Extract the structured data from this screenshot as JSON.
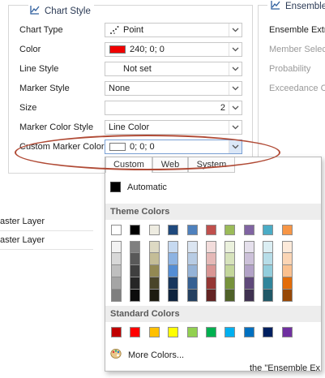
{
  "chart_style": {
    "title": "Chart Style",
    "rows": [
      {
        "label": "Chart Type",
        "value": "Point",
        "has_dropdown": true
      },
      {
        "label": "Color",
        "value": "240; 0; 0",
        "has_dropdown": true
      },
      {
        "label": "Line Style",
        "value": "Not set",
        "has_dropdown": true
      },
      {
        "label": "Marker Style",
        "value": "None",
        "has_dropdown": true
      },
      {
        "label": "Size",
        "value": "2",
        "has_dropdown": true
      },
      {
        "label": "Marker Color Style",
        "value": "Line Color",
        "has_dropdown": true
      },
      {
        "label": "Custom Marker Color",
        "value": "0; 0; 0",
        "has_dropdown": true
      }
    ],
    "color_swatch": "#f00000",
    "marker_swatch": "#ffffff"
  },
  "ensemble": {
    "title": "Ensemble",
    "labels": [
      "Ensemble Extr",
      "Member Select",
      "Probability",
      "Exceedance C"
    ]
  },
  "left_table": {
    "rows": [
      "aster Layer",
      "aster Layer"
    ]
  },
  "color_picker": {
    "tabs": [
      "Custom",
      "Web",
      "System"
    ],
    "automatic_label": "Automatic",
    "theme_title": "Theme Colors",
    "standard_title": "Standard Colors",
    "more_colors_label": "More Colors...",
    "theme_top": [
      "#ffffff",
      "#000000",
      "#eeece1",
      "#1f497d",
      "#4f81bd",
      "#c0504d",
      "#9bbb59",
      "#8064a2",
      "#4bacc6",
      "#f79646"
    ],
    "theme_shades": [
      [
        "#f2f2f2",
        "#7f7f7f",
        "#ddd9c3",
        "#c6d9f0",
        "#dbe5f1",
        "#f2dcdb",
        "#ebf1dd",
        "#e5e0ec",
        "#dbeef3",
        "#fdeada"
      ],
      [
        "#d8d8d8",
        "#595959",
        "#c4bd97",
        "#8db3e2",
        "#b8cce4",
        "#e5b9b7",
        "#d7e3bc",
        "#ccc1d9",
        "#b7dde8",
        "#fbd5b5"
      ],
      [
        "#bfbfbf",
        "#3f3f3f",
        "#938953",
        "#548dd4",
        "#95b3d7",
        "#d99694",
        "#c3d69b",
        "#b2a2c7",
        "#92cddc",
        "#fac08f"
      ],
      [
        "#a5a5a5",
        "#262626",
        "#494429",
        "#17365d",
        "#366092",
        "#953734",
        "#76923c",
        "#5f497a",
        "#31859b",
        "#e36c09"
      ],
      [
        "#7f7f7f",
        "#0c0c0c",
        "#1d1b10",
        "#0f243e",
        "#244061",
        "#632423",
        "#4f6128",
        "#3f3151",
        "#205867",
        "#974806"
      ]
    ],
    "standard": [
      "#c00000",
      "#ff0000",
      "#ffc000",
      "#ffff00",
      "#92d050",
      "#00b050",
      "#00b0f0",
      "#0070c0",
      "#002060",
      "#7030a0"
    ]
  },
  "bottom_text": "the \"Ensemble Ex"
}
